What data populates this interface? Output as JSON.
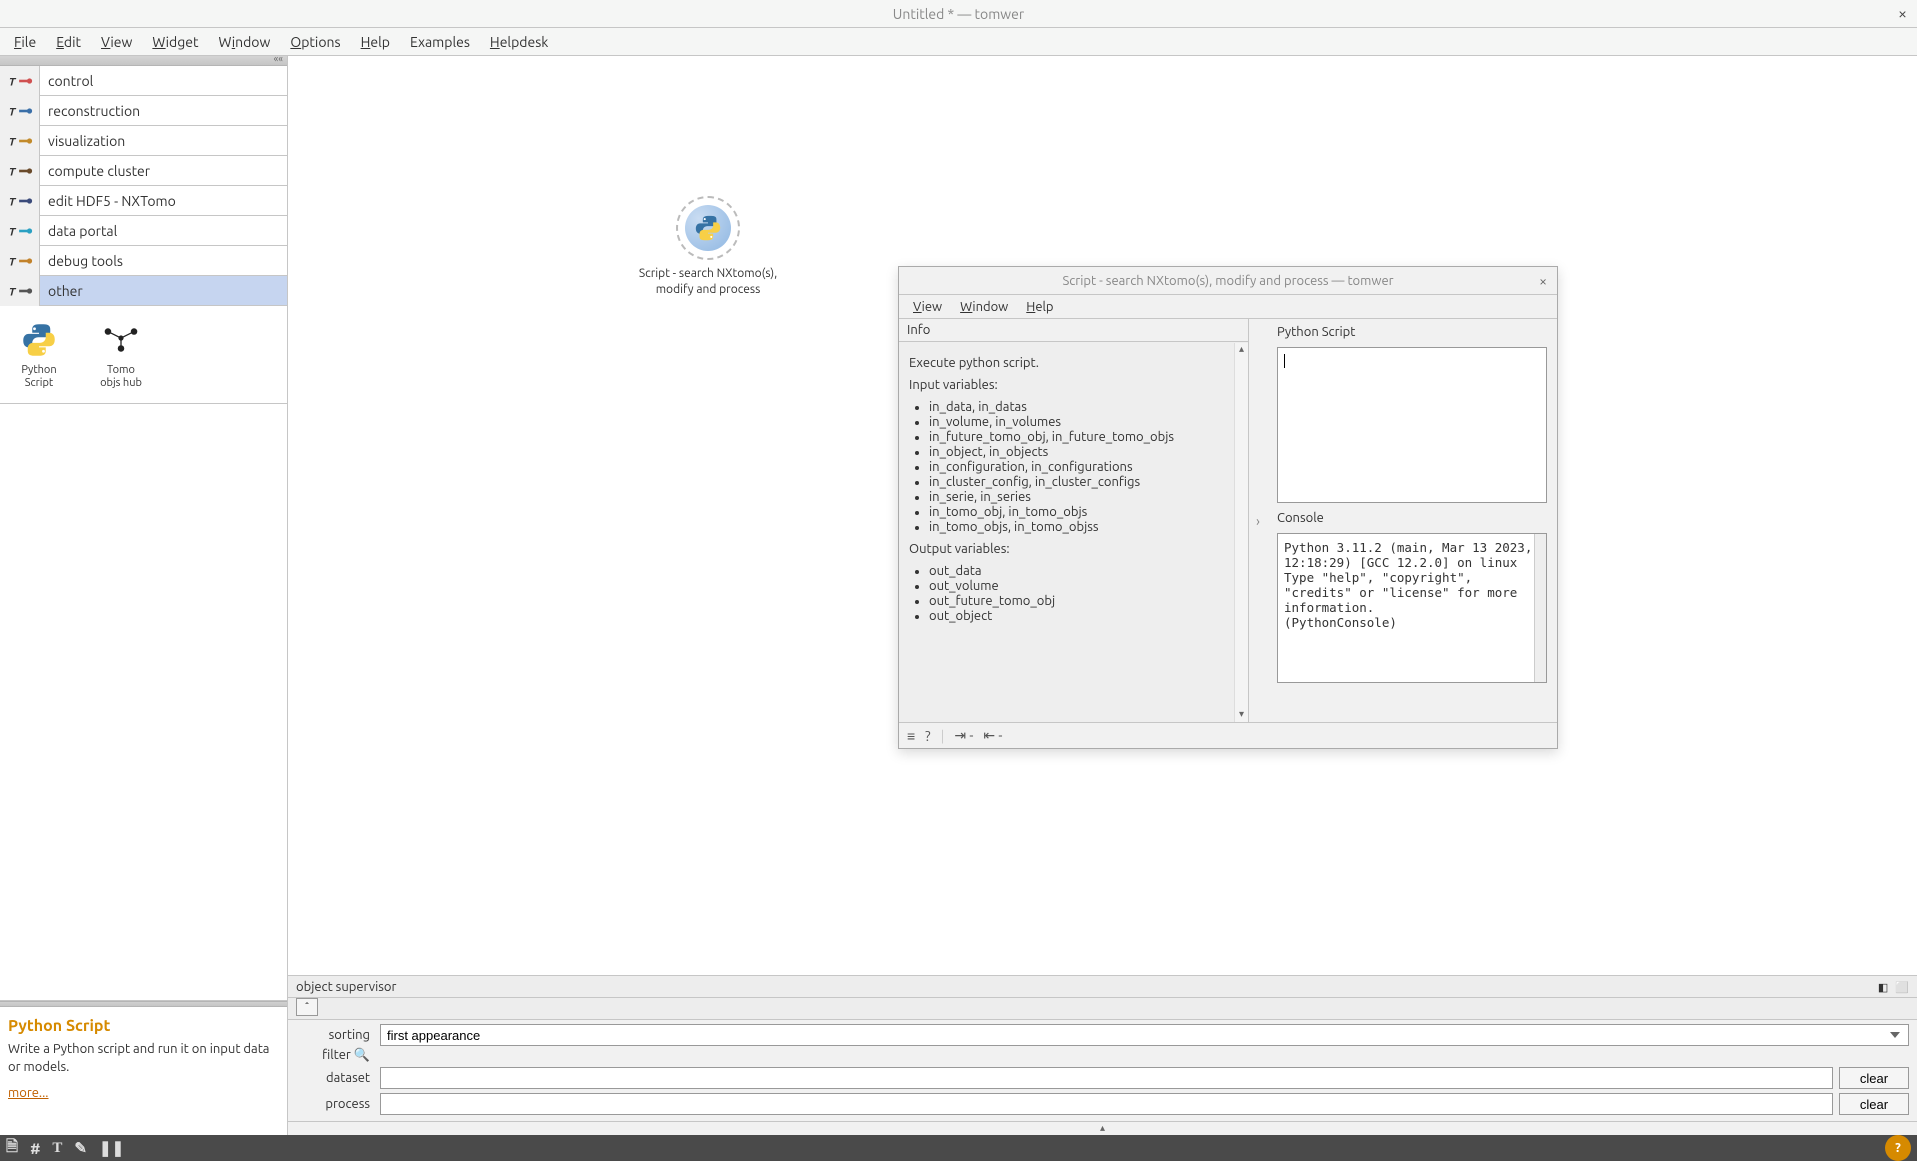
{
  "window": {
    "title": "Untitled * — tomwer"
  },
  "menubar": {
    "file": "File",
    "edit": "Edit",
    "view": "View",
    "widget": "Widget",
    "window": "Window",
    "options": "Options",
    "help": "Help",
    "examples": "Examples",
    "helpdesk": "Helpdesk"
  },
  "categories": [
    {
      "label": "control"
    },
    {
      "label": "reconstruction"
    },
    {
      "label": "visualization"
    },
    {
      "label": "compute cluster"
    },
    {
      "label": "edit HDF5 - NXTomo"
    },
    {
      "label": "data portal"
    },
    {
      "label": "debug tools"
    },
    {
      "label": "other",
      "selected": true
    }
  ],
  "widgets": {
    "python_script": {
      "line1": "Python",
      "line2": "Script"
    },
    "tomo_hub": {
      "line1": "Tomo",
      "line2": "objs hub"
    }
  },
  "description": {
    "title": "Python Script",
    "body": "Write a Python script and run it on input data or models.",
    "more": "more..."
  },
  "canvas_node": {
    "label": "Script - search NXtomo(s), modify and process"
  },
  "dialog": {
    "title": "Script - search NXtomo(s), modify and  process — tomwer",
    "menu": {
      "view": "View",
      "window": "Window",
      "help": "Help"
    },
    "info_head": "Info",
    "info_desc": "Execute python script.",
    "input_label": "Input variables:",
    "inputs": [
      "in_data, in_datas",
      "in_volume, in_volumes",
      "in_future_tomo_obj, in_future_tomo_objs",
      "in_object, in_objects",
      "in_configuration, in_configurations",
      "in_cluster_config, in_cluster_configs",
      "in_serie, in_series",
      "in_tomo_obj, in_tomo_objs",
      "in_tomo_objs, in_tomo_objss"
    ],
    "output_label": "Output variables:",
    "outputs": [
      "out_data",
      "out_volume",
      "out_future_tomo_obj",
      "out_object"
    ],
    "script_label": "Python Script",
    "script_value": "",
    "console_label": "Console",
    "console_text": "Python 3.11.2 (main, Mar 13 2023, 12:18:29) [GCC 12.2.0] on linux\nType \"help\", \"copyright\", \"credits\" or \"license\" for more information.\n(PythonConsole)"
  },
  "supervisor": {
    "title": "object supervisor",
    "sorting_label": "sorting",
    "sorting_value": "first appearance",
    "filter_label": "filter",
    "dataset_label": "dataset",
    "process_label": "process",
    "clear": "clear"
  }
}
